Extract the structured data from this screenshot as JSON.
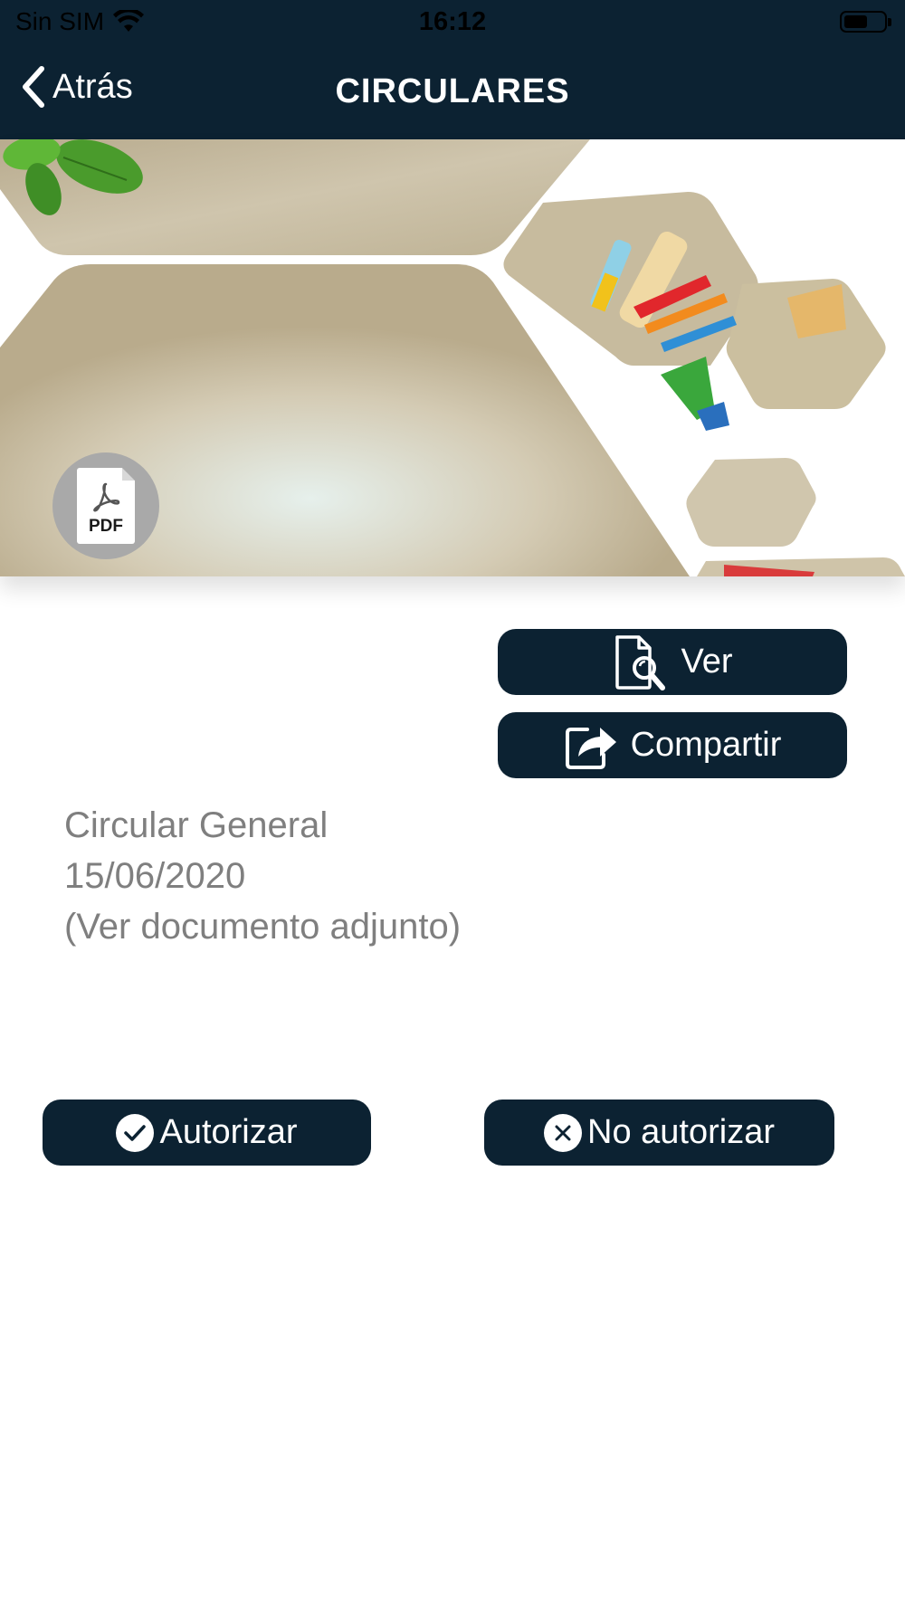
{
  "status_bar": {
    "carrier": "Sin SIM",
    "time": "16:12",
    "battery_level": 0.6
  },
  "nav": {
    "back_label": "Atrás",
    "title": "CIRCULARES"
  },
  "banner": {
    "pdf_label": "PDF",
    "colors": {
      "paper": "#c9bea4",
      "leaf": "#4a9b2c"
    }
  },
  "actions": {
    "view_label": "Ver",
    "share_label": "Compartir"
  },
  "circular": {
    "title": "Circular General",
    "date": "15/06/2020",
    "note": "(Ver documento adjunto)"
  },
  "authorization": {
    "authorize_label": "Autorizar",
    "deny_label": "No autorizar"
  },
  "colors": {
    "header_bg": "#0c2232",
    "button_bg": "#0c2232",
    "body_text": "#7f7f7f"
  }
}
